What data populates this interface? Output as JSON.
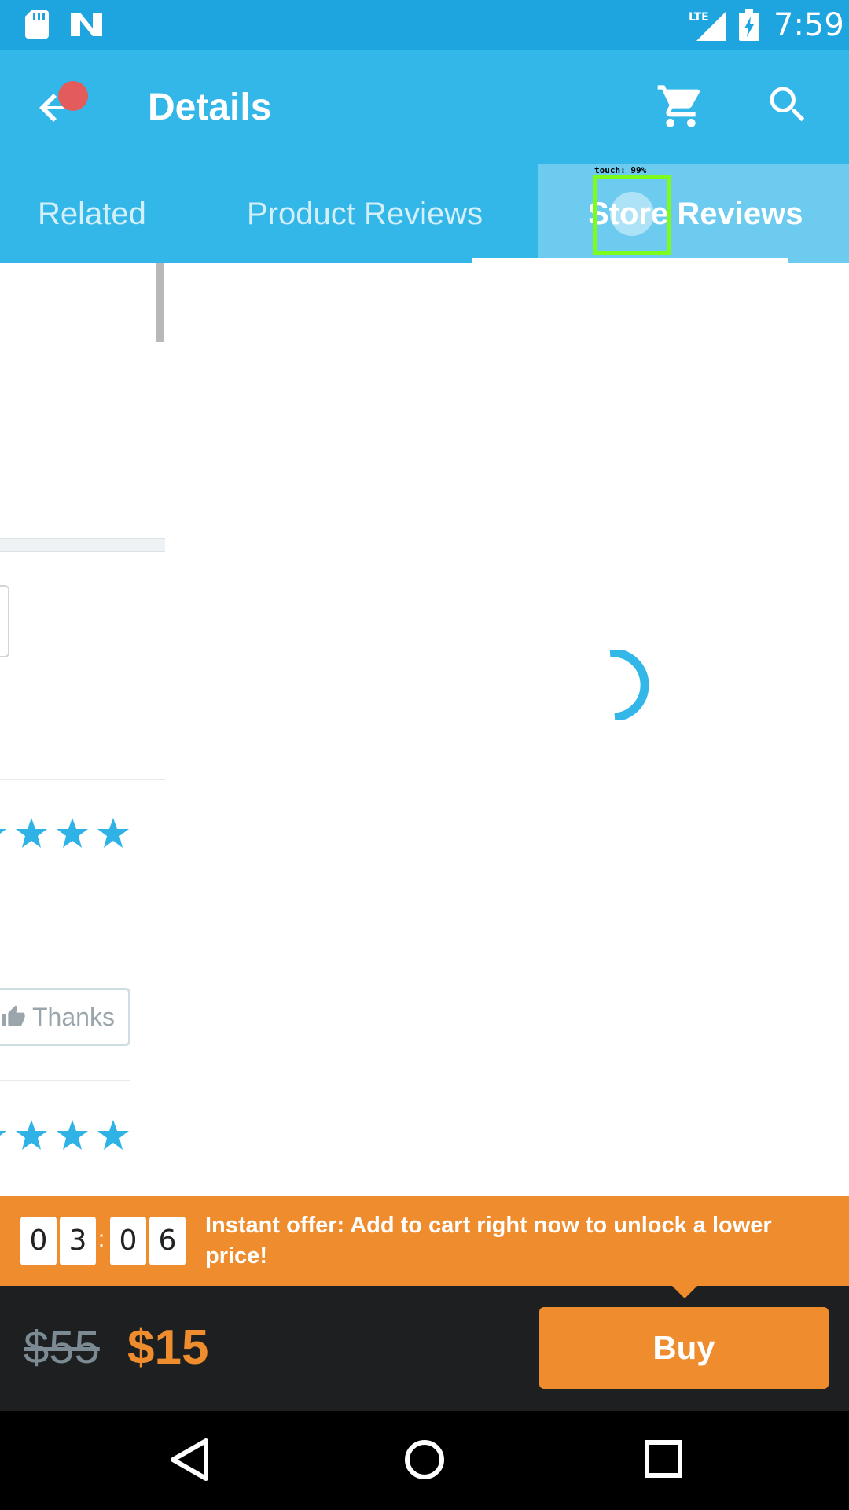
{
  "status_bar": {
    "time": "7:59",
    "network": "LTE",
    "icons": [
      "sd-card-icon",
      "n-notification-icon",
      "lte-signal-icon",
      "battery-charging-icon"
    ]
  },
  "app_bar": {
    "title": "Details",
    "icons": [
      "back-arrow-icon",
      "cart-icon",
      "search-icon"
    ],
    "notification_dot_color": "#e35b5b"
  },
  "tabs": [
    {
      "label": "Related",
      "selected": false
    },
    {
      "label": "Product Reviews",
      "selected": false
    },
    {
      "label": "Store Reviews",
      "selected": true
    }
  ],
  "touch_overlay": {
    "label": "touch: 99%"
  },
  "previous_page_remnant": {
    "thanks_button_label": "Thanks",
    "stars_visible_per_row": 4
  },
  "offer": {
    "timer_digits": [
      "0",
      "3",
      "0",
      "6"
    ],
    "timer_separator": ":",
    "text": "Instant offer: Add to cart right now to unlock a lower price!"
  },
  "pricing": {
    "original_price": "$55",
    "sale_price": "$15",
    "buy_label": "Buy"
  },
  "colors": {
    "status_bar": "#1ea4df",
    "primary": "#33b6e8",
    "accent": "#ee8c2e",
    "bottom_bar": "#1d1f20",
    "star": "#2fb3e6"
  },
  "navigation": {
    "buttons": [
      "nav-back-icon",
      "nav-home-icon",
      "nav-recents-icon"
    ]
  }
}
